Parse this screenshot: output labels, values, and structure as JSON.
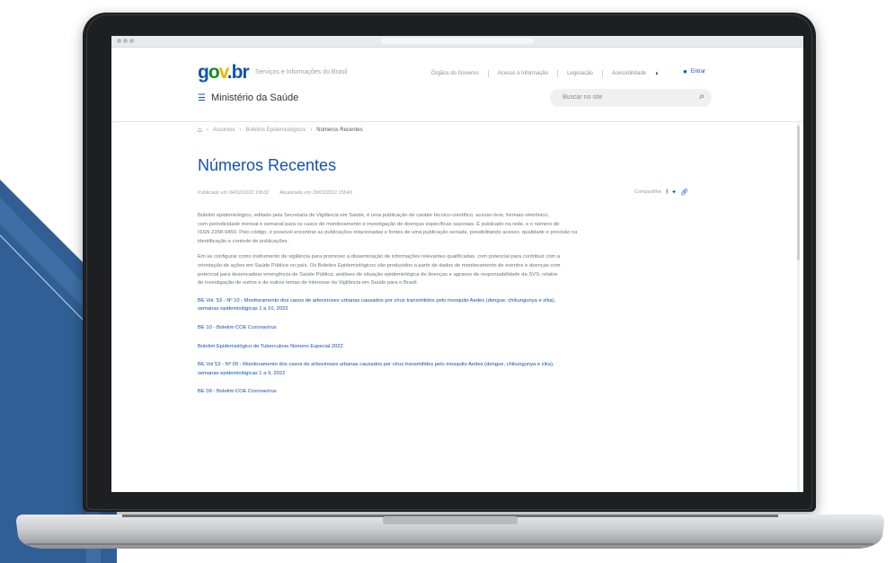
{
  "site": {
    "logo": [
      "g",
      "o",
      "v",
      ".br"
    ],
    "logo_sub": "Serviços e Informações do Brasil",
    "top_links": [
      "Órgãos do Governo",
      "Acesso à Informação",
      "Legislação",
      "Acessibilidade"
    ],
    "login": "Entrar",
    "ministry": "Ministério da Saúde",
    "search_placeholder": "Buscar no site"
  },
  "breadcrumb": [
    "Assuntos",
    "Boletins Epidemiológicos",
    "Números Recentes"
  ],
  "page": {
    "title": "Números Recentes",
    "meta": [
      "Publicado em 04/02/2022 10h32",
      "Atualizado em 28/03/2022 15h43"
    ],
    "share_label": "Compartilhe:"
  },
  "paragraphs": [
    [
      "Boletim epidemiológico, editado pela Secretaria de Vigilância em Saúde, é uma publicação de caráter técnico-científico, acesso livre, formato eletrônico,",
      "com periodicidade mensal e semanal para os casos de monitoramento e investigação de doenças específicas sazonais. É publicado na rede, e o número de",
      "ISSN 2358-9450. Pelo código, é possível encontrar as publicações relacionadas e fontes de uma publicação seriada, possibilitando acesso, qualidade e precisão na",
      "identificação e controle de publicações."
    ],
    [
      "Em se configurar como instrumento de vigilância para promover a disseminação de informações relevantes qualificadas, com potencial para contribuir com a",
      "orientação de ações em Saúde Pública no país. Os Boletins Epidemiológicos são produzidos a partir de dados de monitoramento de eventos e doenças com",
      "potencial para desencadear emergência de Saúde Pública; análises de situação epidemiológica de doenças e agravos de responsabilidade da SVS; relatos",
      "de investigação de surtos e de outros temas de interesse da Vigilância em Saúde para o Brasil."
    ]
  ],
  "links": [
    [
      "BE Vol. 53 - Nº 10 - Monitoramento dos casos de arboviroses urbanas causados por vírus transmitidos pelo mosquito Aedes (dengue, chikungunya e zika),",
      "semanas epidemiológicas 1 a 10, 2022"
    ],
    [
      "BE 10 - Boletim COE Coronavírus"
    ],
    [
      "Boletim Epidemiológico de Tuberculose Número Especial 2022"
    ],
    [
      "BE Vol 53 - Nº 09 - Monitoramento dos casos de arboviroses urbanas causados por vírus transmitidos pelo mosquito Aedes (dengue, chikungunya e zika),",
      "semanas epidemiológicas 1 a 9, 2022"
    ],
    [
      "BE 09 - Boletim COE Coronavírus"
    ]
  ],
  "icons": {
    "home": "home-icon",
    "menu": "hamburger-icon",
    "search": "search-icon",
    "user": "user-icon",
    "share": [
      "facebook-icon",
      "twitter-icon",
      "link-icon"
    ]
  },
  "colors": {
    "primary": "#1351b4",
    "bg_blue": "#2f5f94",
    "laptop": "#1e1f21"
  }
}
